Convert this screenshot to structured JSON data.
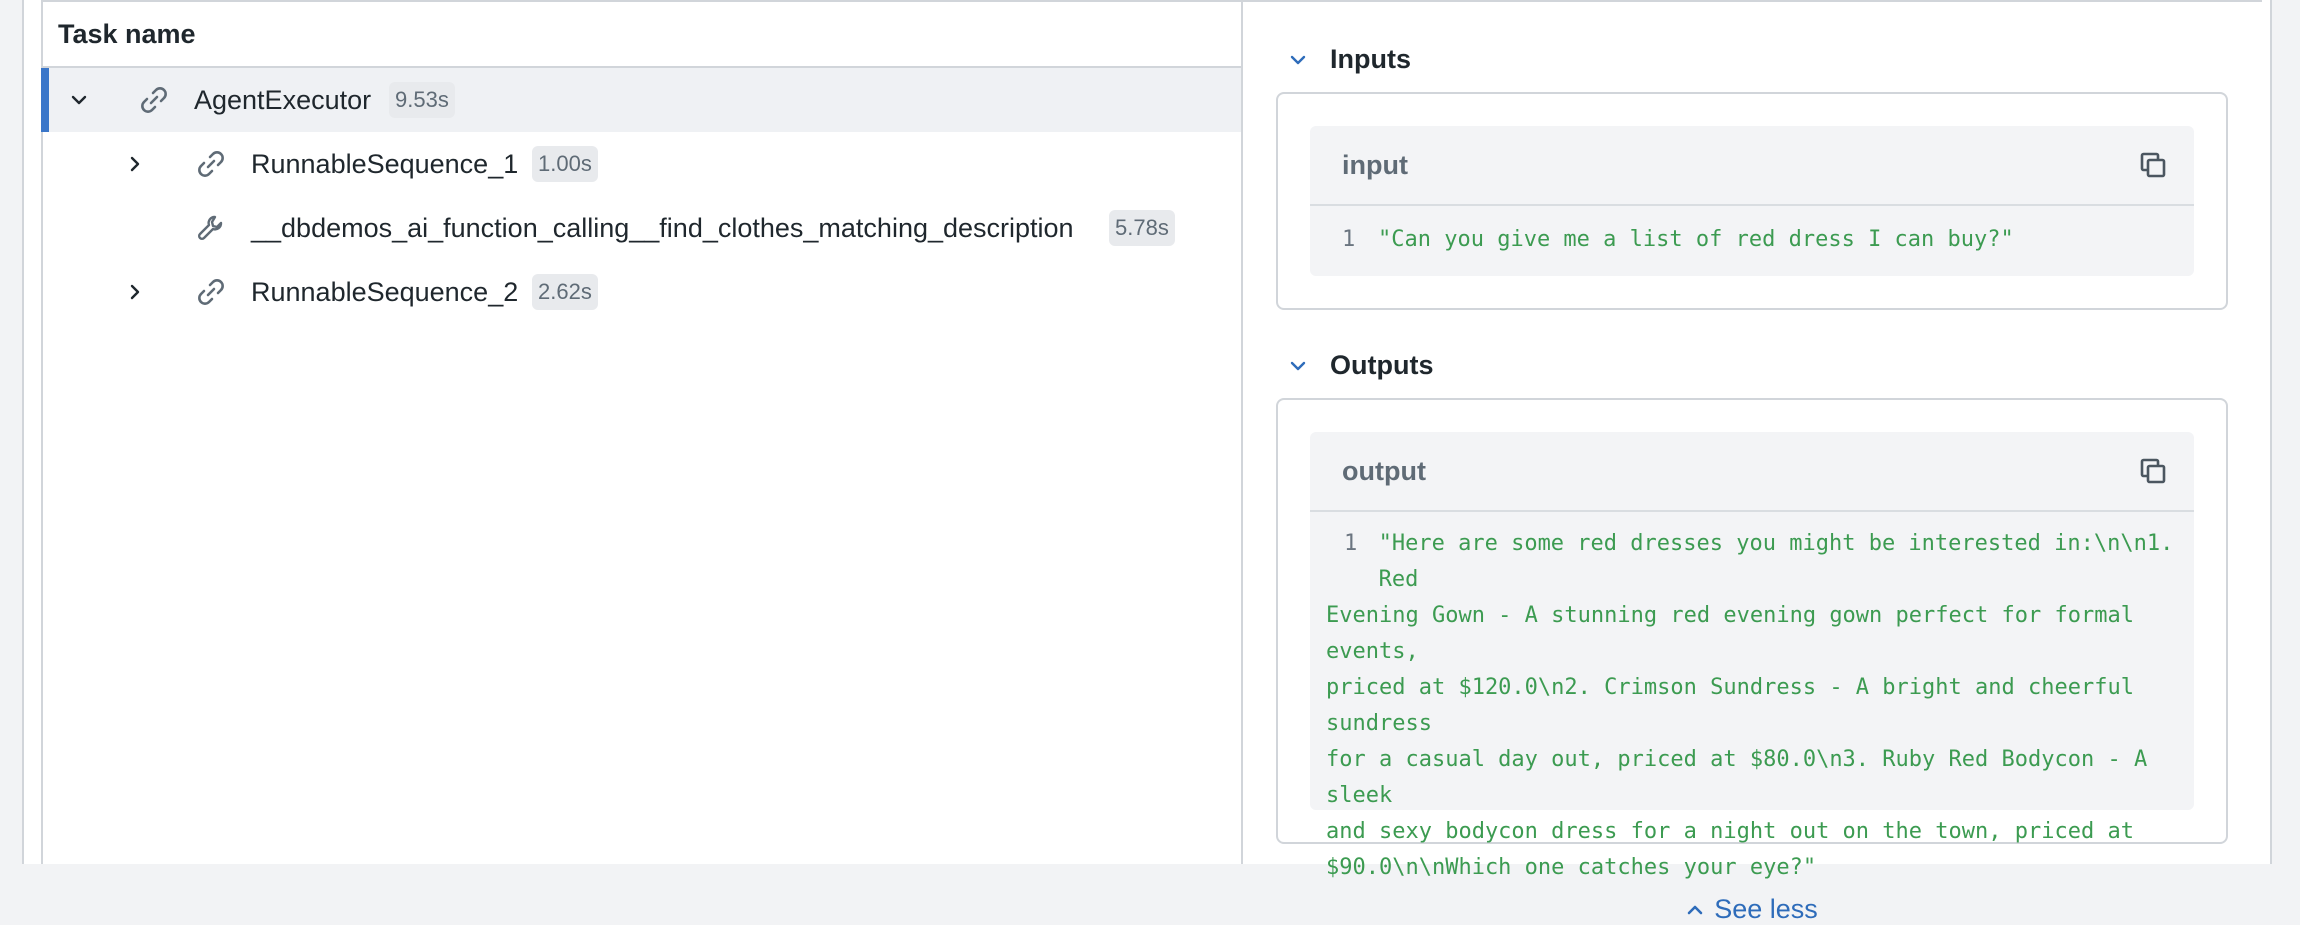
{
  "tree": {
    "header": "Task name",
    "rows": [
      {
        "label": "AgentExecutor",
        "duration": "9.53s",
        "icon": "link-icon",
        "expand": "chevron-down-icon"
      },
      {
        "label": "RunnableSequence_1",
        "duration": "1.00s",
        "icon": "link-icon",
        "expand": "chevron-right-icon"
      },
      {
        "label": "__dbdemos_ai_function_calling__find_clothes_matching_description",
        "duration": "5.78s",
        "icon": "wrench-icon",
        "expand": ""
      },
      {
        "label": "RunnableSequence_2",
        "duration": "2.62s",
        "icon": "link-icon",
        "expand": "chevron-right-icon"
      }
    ]
  },
  "inputs": {
    "title": "Inputs",
    "field_name": "input",
    "line_number": "1",
    "value": "\"Can you give me a list of red dress I can buy?\""
  },
  "outputs": {
    "title": "Outputs",
    "field_name": "output",
    "line_number": "1",
    "lines": [
      "\"Here are some red dresses you might be interested in:\\n\\n1. Red",
      "Evening Gown - A stunning red evening gown perfect for formal events,",
      "priced at $120.0\\n2. Crimson Sundress - A bright and cheerful sundress",
      "for a casual day out, priced at $80.0\\n3. Ruby Red Bodycon - A sleek",
      "and sexy bodycon dress for a night out on the town, priced at",
      "$90.0\\n\\nWhich one catches your eye?\""
    ],
    "see_less": "See less"
  },
  "colors": {
    "accent": "#3a76c9",
    "code_text": "#3c9b51",
    "link": "#2e6cba"
  }
}
